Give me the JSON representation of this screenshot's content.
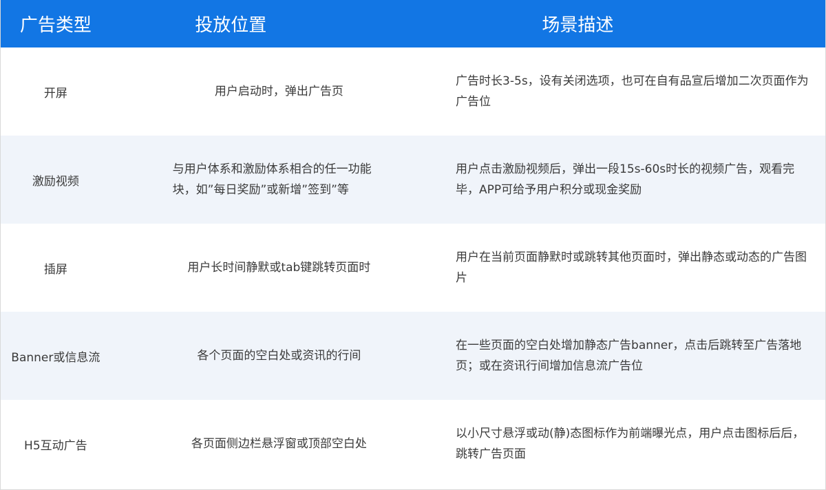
{
  "header": {
    "type": "广告类型",
    "position": "投放位置",
    "description": "场景描述"
  },
  "rows": [
    {
      "type": "开屏",
      "position": "用户启动时，弹出广告页",
      "description": "广告时长3-5s，设有关闭选项，也可在自有品宣后增加二次页面作为广告位"
    },
    {
      "type": "激励视频",
      "position": "与用户体系和激励体系相合的任一功能块，如”每日奖励”或新增”签到”等",
      "description": "用户点击激励视频后，弹出一段15s-60s时长的视频广告，观看完毕，APP可给予用户积分或现金奖励"
    },
    {
      "type": "插屏",
      "position": "用户长时间静默或tab键跳转页面时",
      "description": "用户在当前页面静默时或跳转其他页面时，弹出静态或动态的广告图片"
    },
    {
      "type": "Banner或信息流",
      "position": "各个页面的空白处或资讯的行间",
      "description": "在一些页面的空白处增加静态广告banner，点击后跳转至广告落地页；或在资讯行间增加信息流广告位"
    },
    {
      "type": "H5互动广告",
      "position": "各页面侧边栏悬浮窗或顶部空白处",
      "description": "以小尺寸悬浮或动(静)态图标作为前端曝光点，用户点击图标后后，跳转广告页面"
    }
  ]
}
